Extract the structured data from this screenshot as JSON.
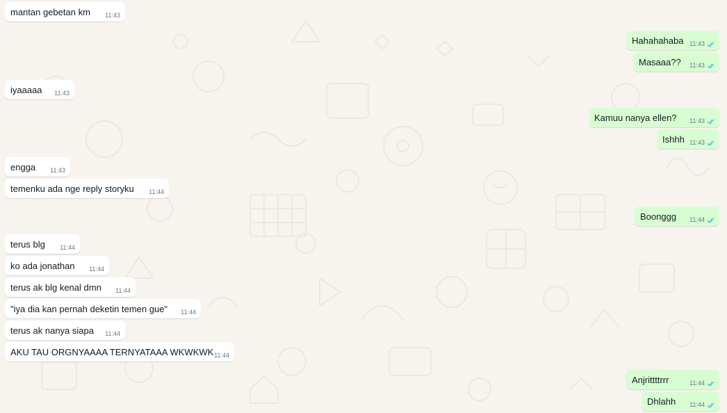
{
  "colors": {
    "background": "#f7f3ef",
    "incoming_bubble": "#ffffff",
    "outgoing_bubble": "#d9fdd3",
    "timestamp": "#667781",
    "read_check": "#53bdeb"
  },
  "messages": [
    {
      "dir": "in",
      "text": "mantan gebetan km",
      "time": "11:43"
    },
    {
      "dir": "out",
      "text": "Hahahahaba",
      "time": "11:43",
      "status": "read"
    },
    {
      "dir": "out",
      "text": "Masaaa??",
      "time": "11:43",
      "status": "read"
    },
    {
      "dir": "in",
      "text": "iyaaaaa",
      "time": "11:43"
    },
    {
      "dir": "out",
      "text": "Kamuu nanya ellen?",
      "time": "11:43",
      "status": "read"
    },
    {
      "dir": "out",
      "text": "Ishhh",
      "time": "11:43",
      "status": "read"
    },
    {
      "dir": "in",
      "text": "engga",
      "time": "11:43"
    },
    {
      "dir": "in",
      "text": "temenku ada nge reply storyku",
      "time": "11:44"
    },
    {
      "dir": "out",
      "text": "Boonggg",
      "time": "11:44",
      "status": "read"
    },
    {
      "dir": "in",
      "text": "terus blg",
      "time": "11:44"
    },
    {
      "dir": "in",
      "text": "ko ada jonathan",
      "time": "11:44"
    },
    {
      "dir": "in",
      "text": "terus ak blg kenal dmn",
      "time": "11:44"
    },
    {
      "dir": "in",
      "text": "\"iya dia kan pernah deketin temen gue\"",
      "time": "11:44"
    },
    {
      "dir": "in",
      "text": "terus ak nanya siapa",
      "time": "11:44"
    },
    {
      "dir": "in",
      "text": "AKU TAU ORGNYAAAA TERNYATAAA WKWKWK",
      "time": "11:44"
    },
    {
      "dir": "out",
      "text": "Anjrittttrrr",
      "time": "11:44",
      "status": "read"
    },
    {
      "dir": "out",
      "text": "Dhlahh",
      "time": "11:44",
      "status": "read"
    }
  ]
}
